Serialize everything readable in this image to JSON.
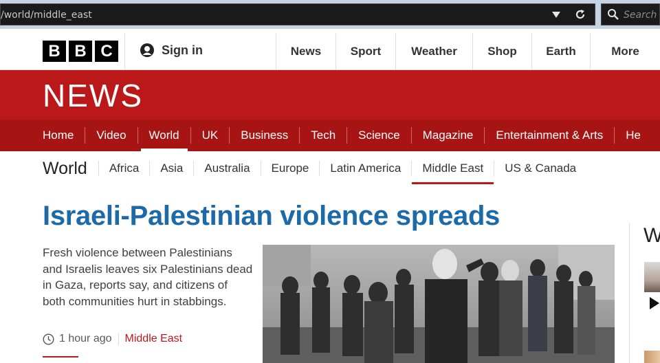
{
  "browser": {
    "url": "/world/middle_east",
    "search_placeholder": "Search"
  },
  "masthead": {
    "logo_letters": [
      "B",
      "B",
      "C"
    ],
    "sign_in": "Sign in",
    "nav": [
      "News",
      "Sport",
      "Weather",
      "Shop",
      "Earth",
      "More"
    ]
  },
  "news": {
    "logo": "NEWS",
    "sections": [
      "Home",
      "Video",
      "World",
      "UK",
      "Business",
      "Tech",
      "Science",
      "Magazine",
      "Entertainment & Arts",
      "He"
    ],
    "active_section": "World"
  },
  "world_nav": {
    "title": "World",
    "items": [
      "Africa",
      "Asia",
      "Australia",
      "Europe",
      "Latin America",
      "Middle East",
      "US & Canada"
    ],
    "active_item": "Middle East"
  },
  "story": {
    "headline": "Israeli-Palestinian violence spreads",
    "summary": "Fresh violence between Palestinians and Israelis leaves six Palestinians dead in Gaza, reports say, and citizens of both communities hurt in stabbings.",
    "time": "1 hour ago",
    "section": "Middle East"
  },
  "right_column": {
    "heading": "W"
  },
  "colors": {
    "bbc_red": "#bb1919",
    "section_bar": "#a61414",
    "headline_blue": "#1d6aa8"
  }
}
